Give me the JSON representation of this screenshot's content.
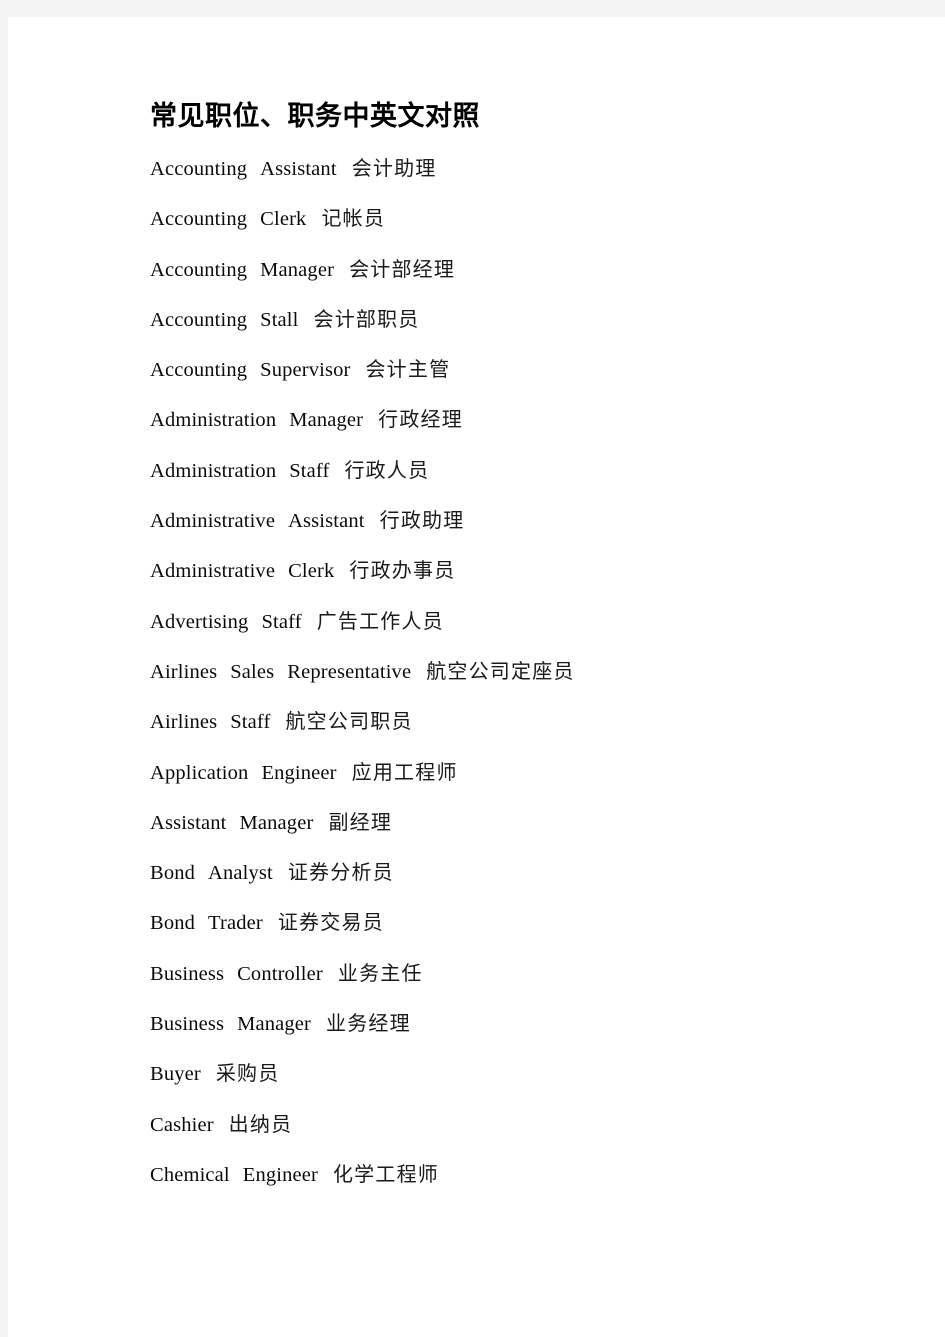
{
  "document": {
    "title": "常见职位、职务中英文对照",
    "page_background": "#ffffff",
    "viewer_background": "#f4f4f4",
    "text_color": "#0a0a0a",
    "entries": [
      {
        "english": "Accounting   Assistant",
        "chinese": "会计助理"
      },
      {
        "english": "Accounting   Clerk",
        "chinese": "记帐员"
      },
      {
        "english": "Accounting   Manager",
        "chinese": "会计部经理"
      },
      {
        "english": "Accounting   Stall",
        "chinese": "会计部职员"
      },
      {
        "english": "Accounting   Supervisor",
        "chinese": "会计主管"
      },
      {
        "english": "Administration   Manager",
        "chinese": "行政经理"
      },
      {
        "english": "Administration   Staff",
        "chinese": "行政人员"
      },
      {
        "english": "Administrative   Assistant",
        "chinese": "行政助理"
      },
      {
        "english": "Administrative   Clerk",
        "chinese": "行政办事员"
      },
      {
        "english": "Advertising   Staff",
        "chinese": "广告工作人员"
      },
      {
        "english": "Airlines   Sales   Representative",
        "chinese": "航空公司定座员"
      },
      {
        "english": "Airlines   Staff",
        "chinese": "航空公司职员"
      },
      {
        "english": "Application   Engineer",
        "chinese": "应用工程师"
      },
      {
        "english": "Assistant   Manager",
        "chinese": "副经理"
      },
      {
        "english": "Bond   Analyst",
        "chinese": "证券分析员"
      },
      {
        "english": "Bond   Trader",
        "chinese": "证券交易员"
      },
      {
        "english": "Business   Controller",
        "chinese": "业务主任"
      },
      {
        "english": "Business   Manager",
        "chinese": "业务经理"
      },
      {
        "english": "Buyer",
        "chinese": "采购员"
      },
      {
        "english": "Cashier",
        "chinese": "出纳员"
      },
      {
        "english": "Chemical   Engineer",
        "chinese": "化学工程师"
      }
    ]
  }
}
